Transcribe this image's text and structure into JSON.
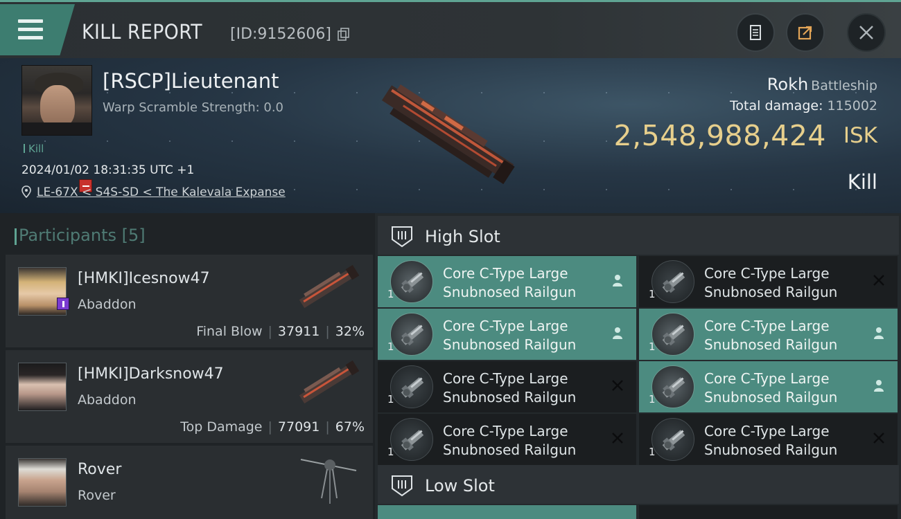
{
  "header": {
    "title": "KILL REPORT",
    "report_id": "[ID:9152606]",
    "icons": [
      "menu-icon",
      "copy-icon",
      "clipboard-icon",
      "share-icon",
      "close-icon"
    ]
  },
  "victim": {
    "name": "[RSCP]Lieutenant",
    "warp_scramble": "Warp Scramble Strength: 0.0",
    "kill_tag": "Kill",
    "datetime": "2024/01/02 18:31:35 UTC +1",
    "location": "LE-67X < S4S-SD < The Kalevala Expanse",
    "ship_name": "Rokh",
    "ship_class": "Battleship",
    "total_damage_label": "Total damage:",
    "total_damage": "115002",
    "isk_value": "2,548,988,424",
    "isk_unit": "ISK",
    "result": "Kill"
  },
  "participants": {
    "title": "Participants",
    "count": "[5]",
    "items": [
      {
        "name": "[HMKI]Icesnow47",
        "ship": "Abaddon",
        "role": "Final Blow",
        "damage": "37911",
        "percent": "32%"
      },
      {
        "name": "[HMKI]Darksnow47",
        "ship": "Abaddon",
        "role": "Top Damage",
        "damage": "77091",
        "percent": "67%"
      },
      {
        "name": "Rover",
        "ship": "Rover"
      }
    ]
  },
  "slots": {
    "high_slot_label": "High Slot",
    "low_slot_label": "Low Slot",
    "high_modules": [
      {
        "line1": "Core C-Type Large",
        "line2": "Snubnosed Railgun",
        "qty": "1",
        "status": "dropped"
      },
      {
        "line1": "Core C-Type Large",
        "line2": "Snubnosed Railgun",
        "qty": "1",
        "status": "destroyed"
      },
      {
        "line1": "Core C-Type Large",
        "line2": "Snubnosed Railgun",
        "qty": "1",
        "status": "dropped"
      },
      {
        "line1": "Core C-Type Large",
        "line2": "Snubnosed Railgun",
        "qty": "1",
        "status": "dropped"
      },
      {
        "line1": "Core C-Type Large",
        "line2": "Snubnosed Railgun",
        "qty": "1",
        "status": "destroyed"
      },
      {
        "line1": "Core C-Type Large",
        "line2": "Snubnosed Railgun",
        "qty": "1",
        "status": "dropped"
      },
      {
        "line1": "Core C-Type Large",
        "line2": "Snubnosed Railgun",
        "qty": "1",
        "status": "destroyed"
      },
      {
        "line1": "Core C-Type Large",
        "line2": "Snubnosed Railgun",
        "qty": "1",
        "status": "destroyed"
      }
    ]
  },
  "colors": {
    "accent": "#5fa493",
    "dropped_bg": "#4c8b80",
    "isk": "#e7cf8c"
  }
}
